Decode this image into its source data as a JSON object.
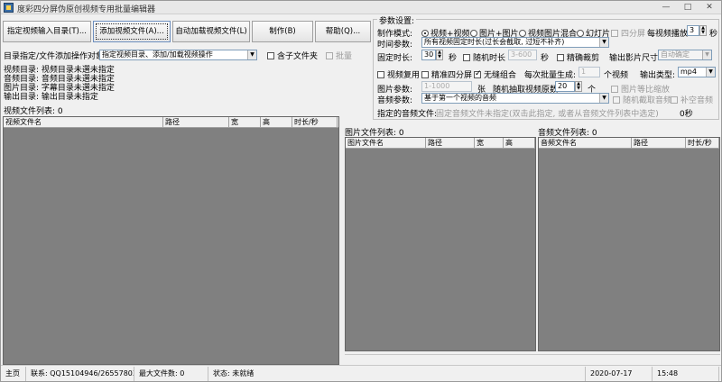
{
  "window": {
    "title": "度彩四分屏伪原创视频专用批量编辑器"
  },
  "toolbar": {
    "import_dir": "指定视频输入目录(T)...",
    "add_file": "添加视频文件(A)...",
    "auto_load": "自动加载视频文件(L)",
    "make": "制作(B)",
    "help": "帮助(Q)..."
  },
  "left": {
    "target_label": "目录指定/文件添加操作对象:",
    "target_value": "指定视频目录、添加/加载视频操作",
    "include_subdir": "含子文件夹",
    "batch": "批量",
    "dirs": [
      {
        "label": "视频目录:",
        "value": "视频目录未選未指定"
      },
      {
        "label": "音频目录:",
        "value": "音频目录未選未指定"
      },
      {
        "label": "图片目录:",
        "value": "字幕目录未選未指定"
      },
      {
        "label": "输出目录:",
        "value": "输出目录未指定"
      }
    ],
    "video_list_label": "视频文件列表: 0",
    "video_cols": [
      "视频文件名",
      "路径",
      "宽",
      "高",
      "时长/秒"
    ]
  },
  "params": {
    "title": "参数设置:",
    "mode_label": "制作模式:",
    "modes": [
      "视频+视频",
      "图片+图片",
      "视频图片混合",
      "幻灯片"
    ],
    "four_screen": "四分屏",
    "per_video_label": "每视频播放",
    "per_video_value": "3",
    "per_video_unit": "秒",
    "time_label": "时间参数:",
    "time_value": "所有视频固定时长(过长会截取, 过短不补齐)",
    "fixed_label": "固定时长:",
    "fixed_value": "30",
    "fixed_unit": "秒",
    "random_label": "随机时长",
    "random_value": "3-600",
    "random_unit": "秒",
    "crop_label": "精确裁剪",
    "output_size_label": "输出影片尺寸:",
    "output_size_value": "自动确定",
    "reuse_label": "视频复用",
    "precise4_label": "精准四分屏",
    "seamless_label": "无缝组合",
    "batch_gen_label": "每次批量生成:",
    "batch_gen_value": "1",
    "batch_gen_unit": "个视频",
    "output_type_label": "输出类型:",
    "output_type_value": "mp4",
    "image_param_label": "图片参数:",
    "image_param_value": "1-1000",
    "image_param_unit": "张",
    "random_sample_label": "随机抽取视频原数:",
    "random_sample_value": "20",
    "random_sample_unit": "个",
    "image_ratio_label": "图片等比缩放",
    "audio_label": "音频参数:",
    "audio_value": "基于第一个视频的音频",
    "random_cut_audio": "随机截取音频",
    "keep_audio": "补空音频",
    "specified_audio_label": "指定的音频文件:",
    "specified_audio_value": "固定音频文件未指定(双击此指定, 或者从音频文件列表中选定)",
    "specified_audio_sec": "0秒"
  },
  "image_list": {
    "label": "图片文件列表: 0",
    "cols": [
      "图片文件名",
      "路径",
      "宽",
      "高"
    ]
  },
  "audio_list": {
    "label": "音频文件列表: 0",
    "cols": [
      "音频文件名",
      "路径",
      "时长/秒"
    ]
  },
  "status": {
    "home": "主页",
    "contact": "联系: QQ15104946/2655780380-",
    "max_files": "最大文件数: 0",
    "state": "状态: 未就绪",
    "date": "2020-07-17",
    "time": "15:48"
  }
}
